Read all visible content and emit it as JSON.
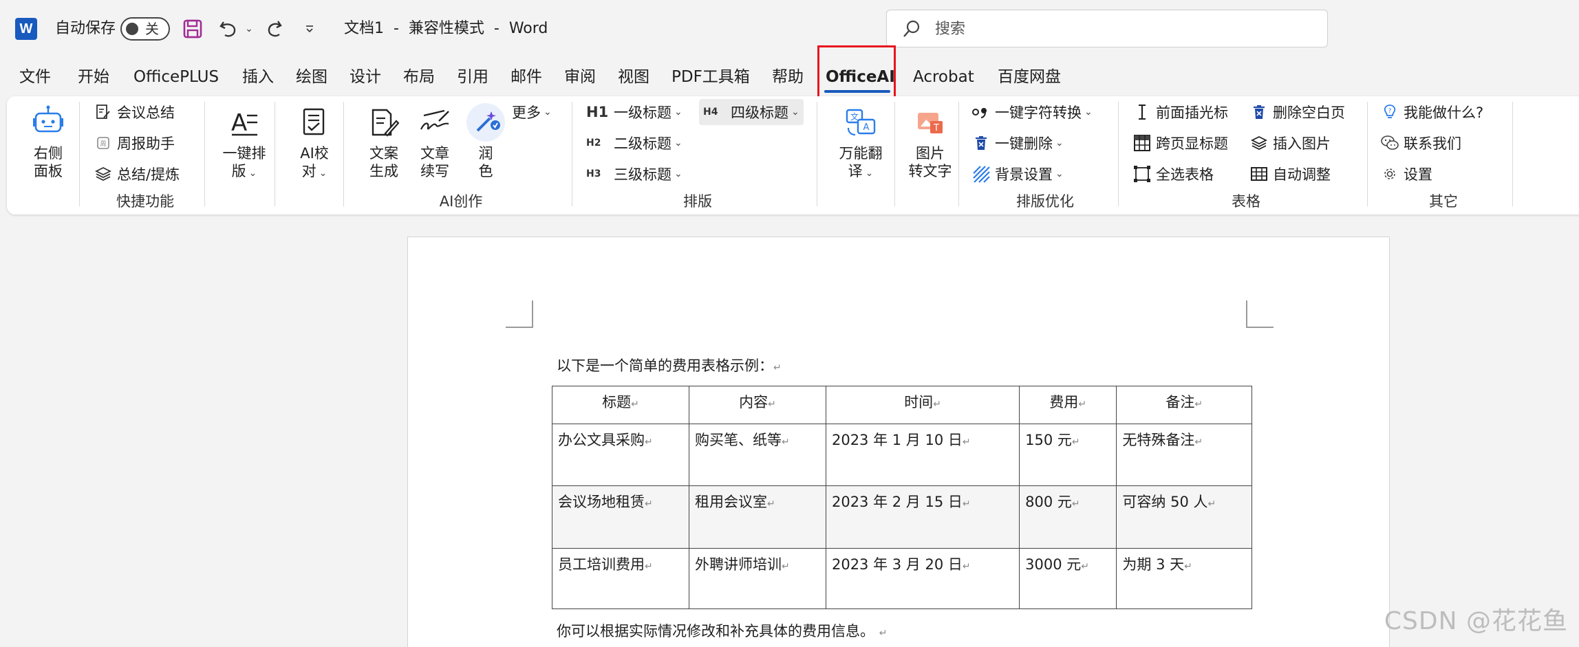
{
  "titlebar": {
    "app_logo_letter": "W",
    "autosave_label": "自动保存",
    "autosave_state": "关",
    "doc_title": "文档1  -  兼容性模式  -  Word",
    "search_placeholder": "搜索"
  },
  "tabs": [
    "文件",
    "开始",
    "OfficePLUS",
    "插入",
    "绘图",
    "设计",
    "布局",
    "引用",
    "邮件",
    "审阅",
    "视图",
    "PDF工具箱",
    "帮助",
    "OfficeAI",
    "Acrobat",
    "百度网盘"
  ],
  "active_tab": "OfficeAI",
  "ribbon": {
    "side_panel": "右侧\n面板",
    "quick": {
      "label": "快捷功能",
      "items": [
        "会议总结",
        "周报助手",
        "总结/提炼"
      ]
    },
    "one_click_layout": "一键排\n版",
    "ai_proofread": "AI校\n对",
    "ai_create": {
      "label": "AI创作",
      "items": [
        "文案\n生成",
        "文章\n续写",
        "润\n色"
      ],
      "more": "更多"
    },
    "layout": {
      "label": "排版",
      "h1": "一级标题",
      "h2": "二级标题",
      "h3": "三级标题",
      "h4": "四级标题",
      "b1": "H1",
      "b2": "H2",
      "b3": "H3",
      "b4": "H4"
    },
    "translate": "万能翻\n译",
    "img_to_text": "图片\n转文字",
    "optimize": {
      "label": "排版优化",
      "items": [
        "一键字符转换",
        "一键删除",
        "背景设置"
      ]
    },
    "table_group": {
      "label": "表格",
      "items": [
        "前面插光标",
        "跨页显标题",
        "全选表格",
        "删除空白页",
        "插入图片",
        "自动调整"
      ]
    },
    "other": {
      "label": "其它",
      "items": [
        "我能做什么?",
        "联系我们",
        "设置"
      ]
    }
  },
  "document": {
    "intro": "以下是一个简单的费用表格示例：",
    "outro": "你可以根据实际情况修改和补充具体的费用信息。",
    "para_mark": "↵",
    "table": {
      "headers": [
        "标题",
        "内容",
        "时间",
        "费用",
        "备注"
      ],
      "rows": [
        [
          "办公文具采购",
          "购买笔、纸等",
          "2023 年 1 月 10 日",
          "150 元",
          "无特殊备注"
        ],
        [
          "会议场地租赁",
          "租用会议室",
          "2023 年 2 月 15 日",
          "800 元",
          "可容纳 50 人"
        ],
        [
          "员工培训费用",
          "外聘讲师培训",
          "2023 年 3 月 20 日",
          "3000 元",
          "为期 3 天"
        ]
      ]
    }
  },
  "watermark": "CSDN @花花鱼",
  "colors": {
    "accent": "#185abd",
    "highlight": "#e8141e",
    "save_icon": "#a02b93"
  }
}
